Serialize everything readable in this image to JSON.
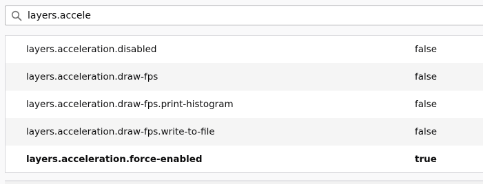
{
  "search": {
    "value": "layers.accele",
    "icon": "search-icon"
  },
  "prefs": [
    {
      "name": "layers.acceleration.disabled",
      "value": "false",
      "modified": false
    },
    {
      "name": "layers.acceleration.draw-fps",
      "value": "false",
      "modified": false
    },
    {
      "name": "layers.acceleration.draw-fps.print-histogram",
      "value": "false",
      "modified": false
    },
    {
      "name": "layers.acceleration.draw-fps.write-to-file",
      "value": "false",
      "modified": false
    },
    {
      "name": "layers.acceleration.force-enabled",
      "value": "true",
      "modified": true
    }
  ]
}
